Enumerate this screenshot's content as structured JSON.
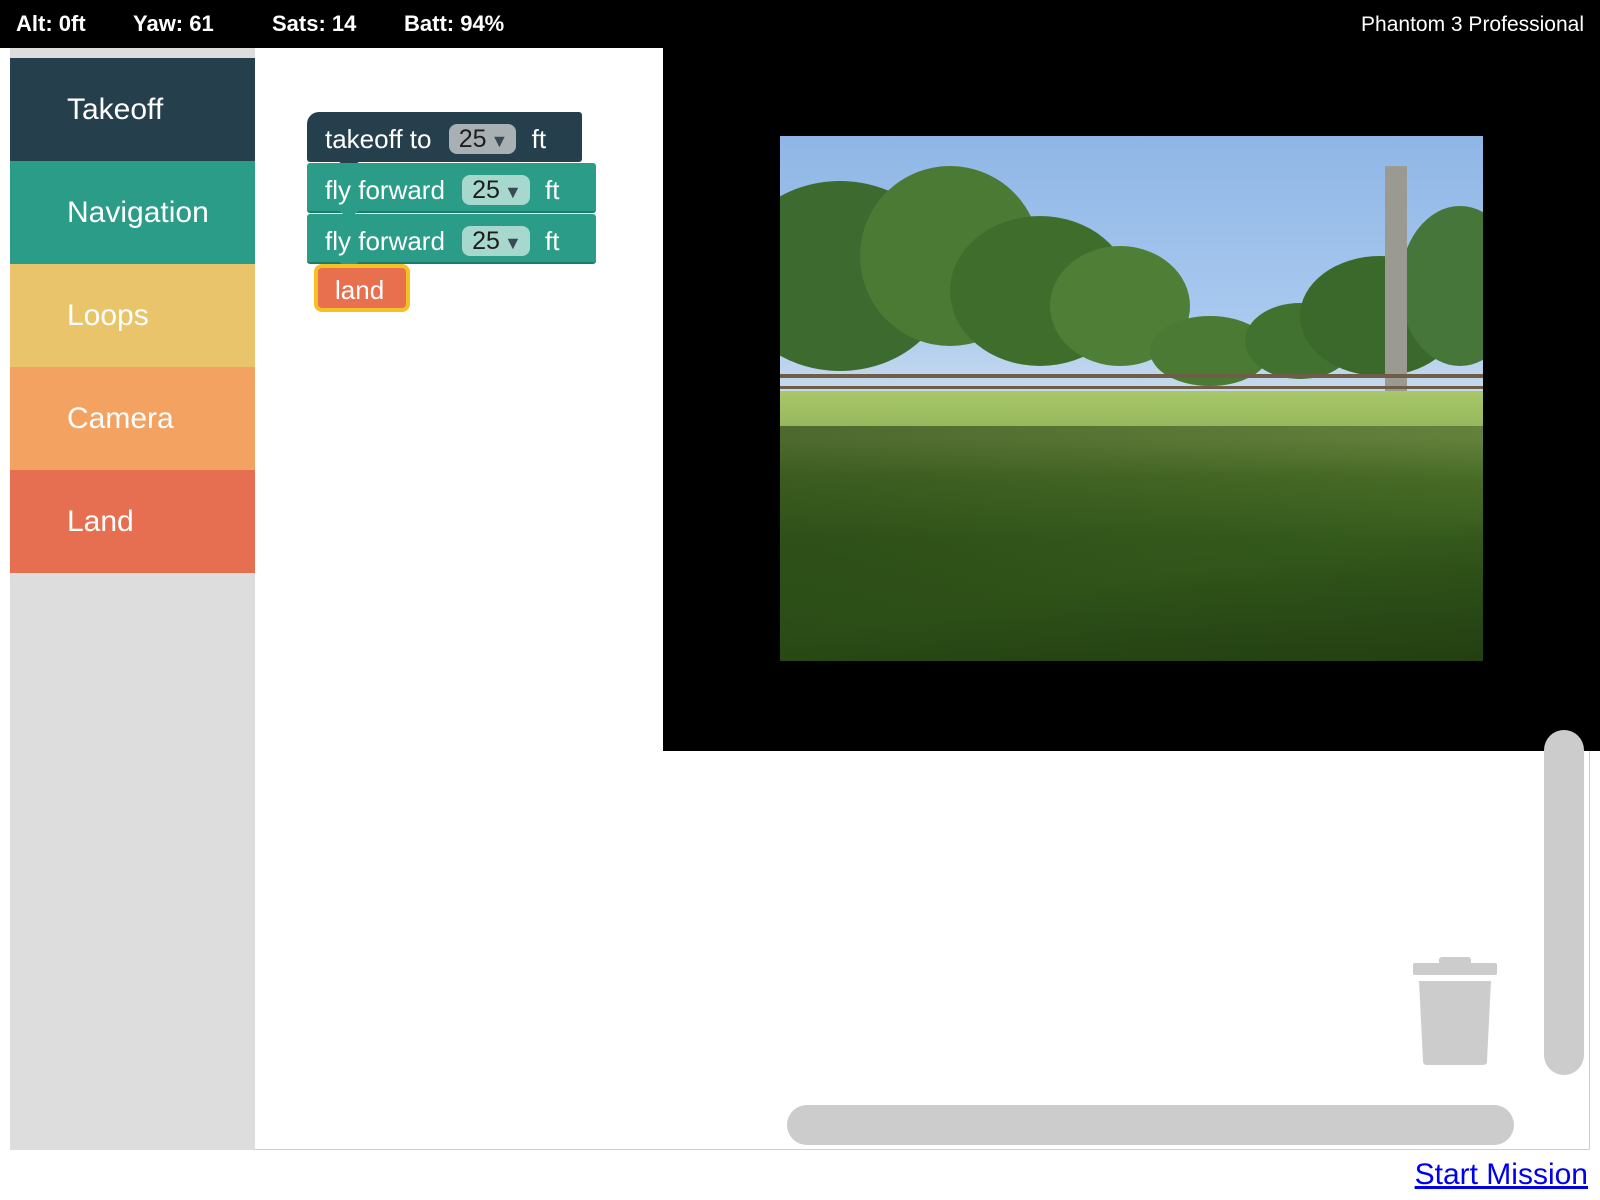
{
  "status": {
    "altitude": "Alt: 0ft",
    "yaw": "Yaw: 61",
    "satellites": "Sats: 14",
    "battery": "Batt: 94%",
    "model": "Phantom 3 Professional"
  },
  "toolbox": {
    "categories": [
      {
        "label": "Takeoff",
        "color": "#263f4c"
      },
      {
        "label": "Navigation",
        "color": "#2b9c88"
      },
      {
        "label": "Loops",
        "color": "#e9c46a"
      },
      {
        "label": "Camera",
        "color": "#f4a261"
      },
      {
        "label": "Land",
        "color": "#e76f51"
      }
    ]
  },
  "blocks": [
    {
      "text": "takeoff to",
      "value": "25",
      "unit": "ft"
    },
    {
      "text": "fly forward",
      "value": "25",
      "unit": "ft"
    },
    {
      "text": "fly forward",
      "value": "25",
      "unit": "ft"
    },
    {
      "text": "land"
    }
  ],
  "icons": {
    "dropdown": "triangle-down-icon",
    "trash": "trash-icon"
  },
  "actions": {
    "start_mission": "Start Mission"
  }
}
